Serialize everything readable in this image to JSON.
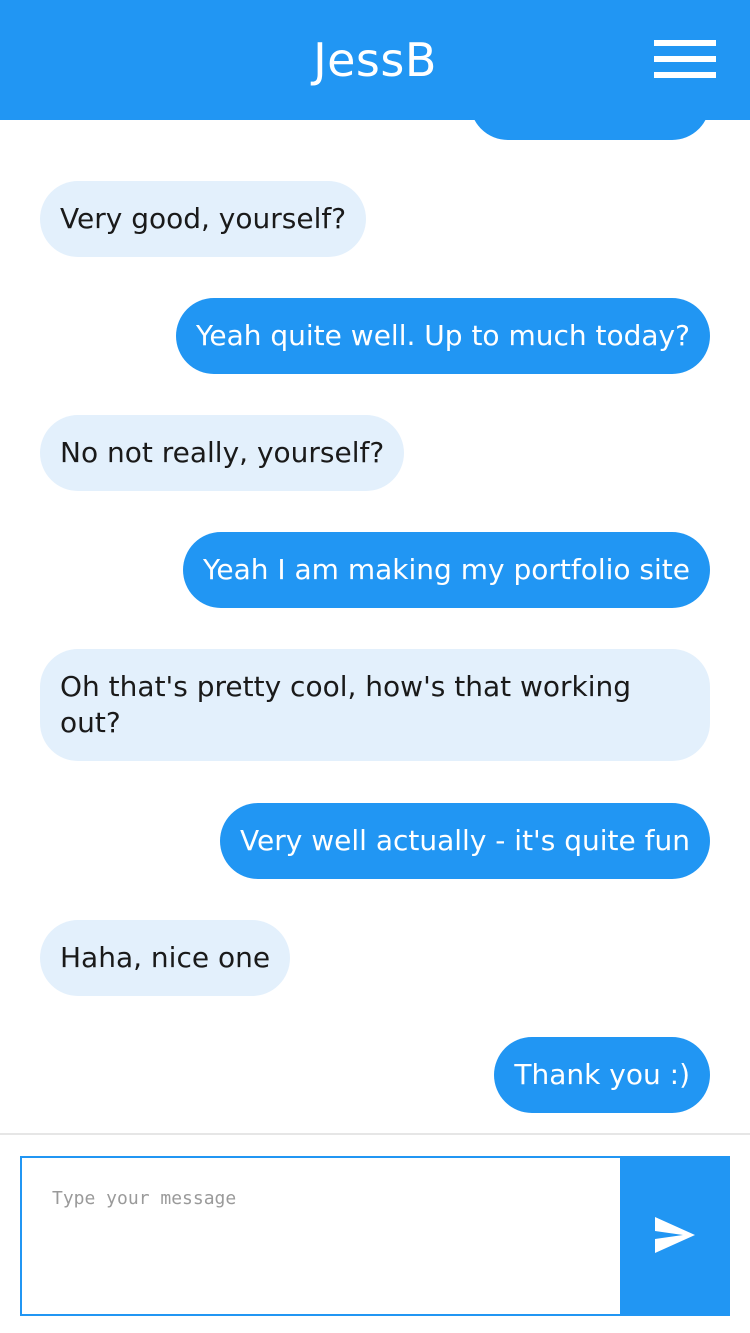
{
  "header": {
    "title": "JessB",
    "menu_icon": "hamburger-menu-icon"
  },
  "colors": {
    "accent": "#2196f3",
    "incoming_bubble": "#e3f0fc",
    "incoming_text": "#1a1a1a",
    "outgoing_text": "#ffffff"
  },
  "messages": [
    {
      "direction": "in",
      "text": "Very good, yourself?"
    },
    {
      "direction": "out",
      "text": "Yeah quite well. Up to much today?"
    },
    {
      "direction": "in",
      "text": "No not really, yourself?"
    },
    {
      "direction": "out",
      "text": "Yeah I am making my portfolio site"
    },
    {
      "direction": "in",
      "text": "Oh that's pretty cool, how's that working out?"
    },
    {
      "direction": "out",
      "text": "Very well actually - it's quite fun"
    },
    {
      "direction": "in",
      "text": "Haha, nice one"
    },
    {
      "direction": "out",
      "text": "Thank you :)"
    }
  ],
  "composer": {
    "placeholder": "Type your message",
    "value": "",
    "send_icon": "send-icon"
  }
}
